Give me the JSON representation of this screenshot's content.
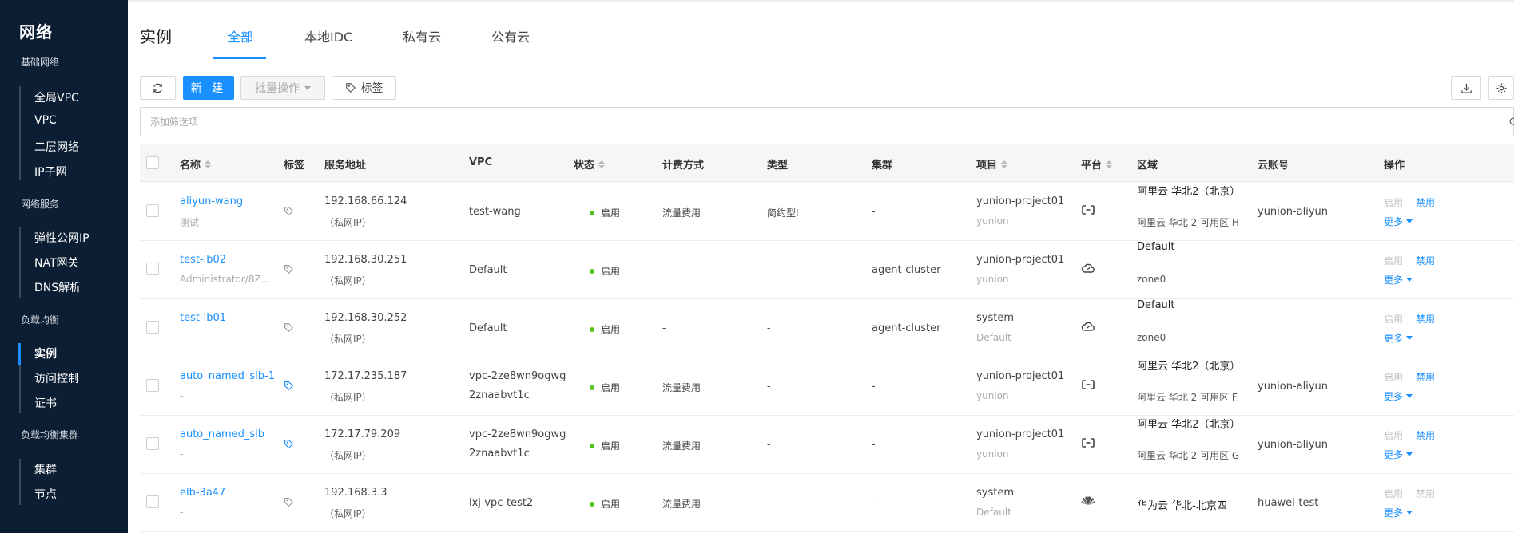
{
  "sidebar": {
    "title": "网络",
    "groups": [
      {
        "label": "基础网络",
        "items": [
          "全局VPC",
          "VPC",
          "二层网络",
          "IP子网"
        ]
      },
      {
        "label": "网络服务",
        "items": [
          "弹性公网IP",
          "NAT网关",
          "DNS解析"
        ]
      },
      {
        "label": "负载均衡",
        "items": [
          "实例",
          "访问控制",
          "证书"
        ]
      },
      {
        "label": "负载均衡集群",
        "items": [
          "集群",
          "节点"
        ]
      }
    ],
    "active_item": "实例"
  },
  "page": {
    "title": "实例",
    "tabs": [
      "全部",
      "本地IDC",
      "私有云",
      "公有云"
    ],
    "active_tab": "全部"
  },
  "toolbar": {
    "create_label": "新 建",
    "batch_label": "批量操作",
    "tag_label": "标签"
  },
  "filter": {
    "placeholder": "添加筛选项"
  },
  "table": {
    "columns": [
      "名称",
      "标签",
      "服务地址",
      "VPC",
      "状态",
      "计费方式",
      "类型",
      "集群",
      "项目",
      "平台",
      "区域",
      "云账号",
      "操作"
    ],
    "rows": [
      {
        "name": "aliyun-wang",
        "desc": "测试",
        "address": "192.168.66.124",
        "addr_type": "（私网IP）",
        "vpc1": "test-wang",
        "vpc2": "",
        "status": "启用",
        "billing": "流量费用",
        "type": "简约型I",
        "cluster": "-",
        "project": "yunion-project01",
        "domain": "yunion",
        "platform": "aliyun",
        "region1": "阿里云 华北2（北京）",
        "region2": "阿里云 华北 2 可用区 H",
        "account": "yunion-aliyun",
        "tag_colored": false,
        "actions": {
          "enable": "启用",
          "disable": "禁用",
          "more": "更多",
          "disable_active": true
        }
      },
      {
        "name": "test-lb02",
        "desc": "Administrator/8Z...",
        "address": "192.168.30.251",
        "addr_type": "（私网IP）",
        "vpc1": "Default",
        "vpc2": "",
        "status": "启用",
        "billing": "-",
        "type": "-",
        "cluster": "agent-cluster",
        "project": "yunion-project01",
        "domain": "yunion",
        "platform": "onecloud",
        "region1": "Default",
        "region2": "zone0",
        "account": "",
        "tag_colored": false,
        "actions": {
          "enable": "启用",
          "disable": "禁用",
          "more": "更多",
          "disable_active": true
        }
      },
      {
        "name": "test-lb01",
        "desc": "-",
        "address": "192.168.30.252",
        "addr_type": "（私网IP）",
        "vpc1": "Default",
        "vpc2": "",
        "status": "启用",
        "billing": "-",
        "type": "-",
        "cluster": "agent-cluster",
        "project": "system",
        "domain": "Default",
        "platform": "onecloud",
        "region1": "Default",
        "region2": "zone0",
        "account": "",
        "tag_colored": false,
        "actions": {
          "enable": "启用",
          "disable": "禁用",
          "more": "更多",
          "disable_active": true
        }
      },
      {
        "name": "auto_named_slb-1",
        "desc": "-",
        "address": "172.17.235.187",
        "addr_type": "（私网IP）",
        "vpc1": "vpc-2ze8wn9ogwg",
        "vpc2": "2znaabvt1c",
        "status": "启用",
        "billing": "流量费用",
        "type": "-",
        "cluster": "-",
        "project": "yunion-project01",
        "domain": "yunion",
        "platform": "aliyun",
        "region1": "阿里云 华北2（北京）",
        "region2": "阿里云 华北 2 可用区 F",
        "account": "yunion-aliyun",
        "tag_colored": true,
        "actions": {
          "enable": "启用",
          "disable": "禁用",
          "more": "更多",
          "disable_active": true
        }
      },
      {
        "name": "auto_named_slb",
        "desc": "-",
        "address": "172.17.79.209",
        "addr_type": "（私网IP）",
        "vpc1": "vpc-2ze8wn9ogwg",
        "vpc2": "2znaabvt1c",
        "status": "启用",
        "billing": "流量费用",
        "type": "-",
        "cluster": "-",
        "project": "yunion-project01",
        "domain": "yunion",
        "platform": "aliyun",
        "region1": "阿里云 华北2（北京）",
        "region2": "阿里云 华北 2 可用区 G",
        "account": "yunion-aliyun",
        "tag_colored": true,
        "actions": {
          "enable": "启用",
          "disable": "禁用",
          "more": "更多",
          "disable_active": true
        }
      },
      {
        "name": "elb-3a47",
        "desc": "-",
        "address": "192.168.3.3",
        "addr_type": "（私网IP）",
        "vpc1": "lxj-vpc-test2",
        "vpc2": "",
        "status": "启用",
        "billing": "流量费用",
        "type": "-",
        "cluster": "-",
        "project": "system",
        "domain": "Default",
        "platform": "huawei",
        "region1": "华为云 华北-北京四",
        "region2": "",
        "account": "huawei-test",
        "tag_colored": false,
        "actions": {
          "enable": "启用",
          "disable": "禁用",
          "more": "更多",
          "disable_active": false
        }
      }
    ]
  },
  "colors": {
    "sidebar_bg": "#0c1e33",
    "accent": "#1890ff",
    "status_green": "#52c41a"
  }
}
